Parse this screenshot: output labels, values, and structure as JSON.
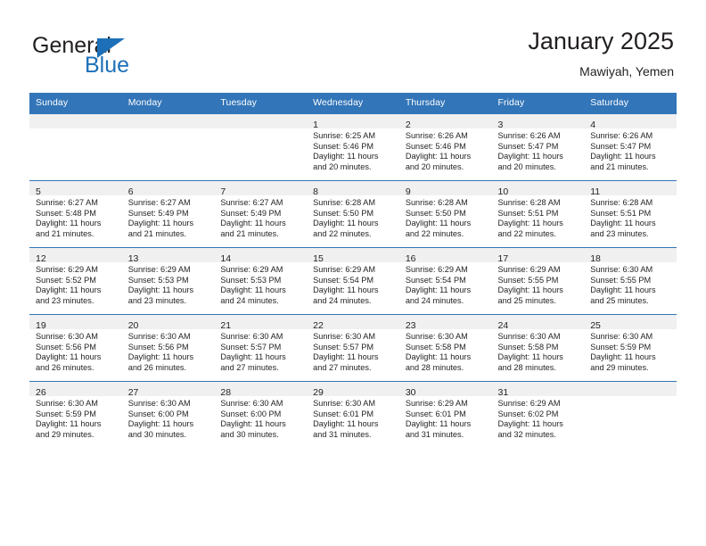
{
  "brand": {
    "name_part1": "General",
    "name_part2": "Blue",
    "logo_icon": "triangle-logo-icon"
  },
  "header": {
    "title": "January 2025",
    "subtitle": "Mawiyah, Yemen"
  },
  "colors": {
    "header_blue": "#3275b8",
    "brand_blue": "#1d70b8",
    "day_strip": "#f0f0f0",
    "text": "#231f20"
  },
  "weekday_headers": [
    "Sunday",
    "Monday",
    "Tuesday",
    "Wednesday",
    "Thursday",
    "Friday",
    "Saturday"
  ],
  "weeks": [
    [
      {
        "day": "",
        "sunrise": "",
        "sunset": "",
        "daylight_line1": "",
        "daylight_line2": "",
        "empty": true
      },
      {
        "day": "",
        "sunrise": "",
        "sunset": "",
        "daylight_line1": "",
        "daylight_line2": "",
        "empty": true
      },
      {
        "day": "",
        "sunrise": "",
        "sunset": "",
        "daylight_line1": "",
        "daylight_line2": "",
        "empty": true
      },
      {
        "day": "1",
        "sunrise": "Sunrise: 6:25 AM",
        "sunset": "Sunset: 5:46 PM",
        "daylight_line1": "Daylight: 11 hours",
        "daylight_line2": "and 20 minutes."
      },
      {
        "day": "2",
        "sunrise": "Sunrise: 6:26 AM",
        "sunset": "Sunset: 5:46 PM",
        "daylight_line1": "Daylight: 11 hours",
        "daylight_line2": "and 20 minutes."
      },
      {
        "day": "3",
        "sunrise": "Sunrise: 6:26 AM",
        "sunset": "Sunset: 5:47 PM",
        "daylight_line1": "Daylight: 11 hours",
        "daylight_line2": "and 20 minutes."
      },
      {
        "day": "4",
        "sunrise": "Sunrise: 6:26 AM",
        "sunset": "Sunset: 5:47 PM",
        "daylight_line1": "Daylight: 11 hours",
        "daylight_line2": "and 21 minutes."
      }
    ],
    [
      {
        "day": "5",
        "sunrise": "Sunrise: 6:27 AM",
        "sunset": "Sunset: 5:48 PM",
        "daylight_line1": "Daylight: 11 hours",
        "daylight_line2": "and 21 minutes."
      },
      {
        "day": "6",
        "sunrise": "Sunrise: 6:27 AM",
        "sunset": "Sunset: 5:49 PM",
        "daylight_line1": "Daylight: 11 hours",
        "daylight_line2": "and 21 minutes."
      },
      {
        "day": "7",
        "sunrise": "Sunrise: 6:27 AM",
        "sunset": "Sunset: 5:49 PM",
        "daylight_line1": "Daylight: 11 hours",
        "daylight_line2": "and 21 minutes."
      },
      {
        "day": "8",
        "sunrise": "Sunrise: 6:28 AM",
        "sunset": "Sunset: 5:50 PM",
        "daylight_line1": "Daylight: 11 hours",
        "daylight_line2": "and 22 minutes."
      },
      {
        "day": "9",
        "sunrise": "Sunrise: 6:28 AM",
        "sunset": "Sunset: 5:50 PM",
        "daylight_line1": "Daylight: 11 hours",
        "daylight_line2": "and 22 minutes."
      },
      {
        "day": "10",
        "sunrise": "Sunrise: 6:28 AM",
        "sunset": "Sunset: 5:51 PM",
        "daylight_line1": "Daylight: 11 hours",
        "daylight_line2": "and 22 minutes."
      },
      {
        "day": "11",
        "sunrise": "Sunrise: 6:28 AM",
        "sunset": "Sunset: 5:51 PM",
        "daylight_line1": "Daylight: 11 hours",
        "daylight_line2": "and 23 minutes."
      }
    ],
    [
      {
        "day": "12",
        "sunrise": "Sunrise: 6:29 AM",
        "sunset": "Sunset: 5:52 PM",
        "daylight_line1": "Daylight: 11 hours",
        "daylight_line2": "and 23 minutes."
      },
      {
        "day": "13",
        "sunrise": "Sunrise: 6:29 AM",
        "sunset": "Sunset: 5:53 PM",
        "daylight_line1": "Daylight: 11 hours",
        "daylight_line2": "and 23 minutes."
      },
      {
        "day": "14",
        "sunrise": "Sunrise: 6:29 AM",
        "sunset": "Sunset: 5:53 PM",
        "daylight_line1": "Daylight: 11 hours",
        "daylight_line2": "and 24 minutes."
      },
      {
        "day": "15",
        "sunrise": "Sunrise: 6:29 AM",
        "sunset": "Sunset: 5:54 PM",
        "daylight_line1": "Daylight: 11 hours",
        "daylight_line2": "and 24 minutes."
      },
      {
        "day": "16",
        "sunrise": "Sunrise: 6:29 AM",
        "sunset": "Sunset: 5:54 PM",
        "daylight_line1": "Daylight: 11 hours",
        "daylight_line2": "and 24 minutes."
      },
      {
        "day": "17",
        "sunrise": "Sunrise: 6:29 AM",
        "sunset": "Sunset: 5:55 PM",
        "daylight_line1": "Daylight: 11 hours",
        "daylight_line2": "and 25 minutes."
      },
      {
        "day": "18",
        "sunrise": "Sunrise: 6:30 AM",
        "sunset": "Sunset: 5:55 PM",
        "daylight_line1": "Daylight: 11 hours",
        "daylight_line2": "and 25 minutes."
      }
    ],
    [
      {
        "day": "19",
        "sunrise": "Sunrise: 6:30 AM",
        "sunset": "Sunset: 5:56 PM",
        "daylight_line1": "Daylight: 11 hours",
        "daylight_line2": "and 26 minutes."
      },
      {
        "day": "20",
        "sunrise": "Sunrise: 6:30 AM",
        "sunset": "Sunset: 5:56 PM",
        "daylight_line1": "Daylight: 11 hours",
        "daylight_line2": "and 26 minutes."
      },
      {
        "day": "21",
        "sunrise": "Sunrise: 6:30 AM",
        "sunset": "Sunset: 5:57 PM",
        "daylight_line1": "Daylight: 11 hours",
        "daylight_line2": "and 27 minutes."
      },
      {
        "day": "22",
        "sunrise": "Sunrise: 6:30 AM",
        "sunset": "Sunset: 5:57 PM",
        "daylight_line1": "Daylight: 11 hours",
        "daylight_line2": "and 27 minutes."
      },
      {
        "day": "23",
        "sunrise": "Sunrise: 6:30 AM",
        "sunset": "Sunset: 5:58 PM",
        "daylight_line1": "Daylight: 11 hours",
        "daylight_line2": "and 28 minutes."
      },
      {
        "day": "24",
        "sunrise": "Sunrise: 6:30 AM",
        "sunset": "Sunset: 5:58 PM",
        "daylight_line1": "Daylight: 11 hours",
        "daylight_line2": "and 28 minutes."
      },
      {
        "day": "25",
        "sunrise": "Sunrise: 6:30 AM",
        "sunset": "Sunset: 5:59 PM",
        "daylight_line1": "Daylight: 11 hours",
        "daylight_line2": "and 29 minutes."
      }
    ],
    [
      {
        "day": "26",
        "sunrise": "Sunrise: 6:30 AM",
        "sunset": "Sunset: 5:59 PM",
        "daylight_line1": "Daylight: 11 hours",
        "daylight_line2": "and 29 minutes."
      },
      {
        "day": "27",
        "sunrise": "Sunrise: 6:30 AM",
        "sunset": "Sunset: 6:00 PM",
        "daylight_line1": "Daylight: 11 hours",
        "daylight_line2": "and 30 minutes."
      },
      {
        "day": "28",
        "sunrise": "Sunrise: 6:30 AM",
        "sunset": "Sunset: 6:00 PM",
        "daylight_line1": "Daylight: 11 hours",
        "daylight_line2": "and 30 minutes."
      },
      {
        "day": "29",
        "sunrise": "Sunrise: 6:30 AM",
        "sunset": "Sunset: 6:01 PM",
        "daylight_line1": "Daylight: 11 hours",
        "daylight_line2": "and 31 minutes."
      },
      {
        "day": "30",
        "sunrise": "Sunrise: 6:29 AM",
        "sunset": "Sunset: 6:01 PM",
        "daylight_line1": "Daylight: 11 hours",
        "daylight_line2": "and 31 minutes."
      },
      {
        "day": "31",
        "sunrise": "Sunrise: 6:29 AM",
        "sunset": "Sunset: 6:02 PM",
        "daylight_line1": "Daylight: 11 hours",
        "daylight_line2": "and 32 minutes."
      },
      {
        "day": "",
        "sunrise": "",
        "sunset": "",
        "daylight_line1": "",
        "daylight_line2": "",
        "empty": true
      }
    ]
  ]
}
